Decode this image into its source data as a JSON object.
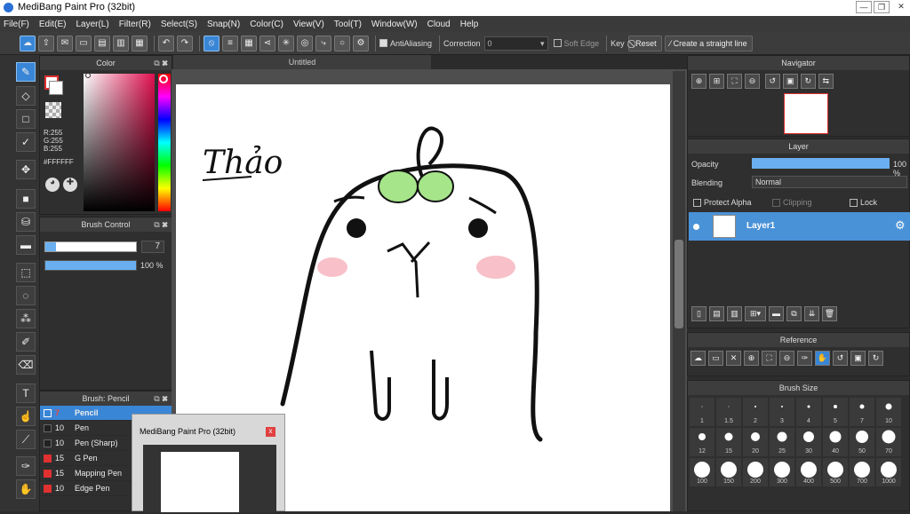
{
  "window": {
    "title": "MediBang Paint Pro (32bit)",
    "min": "—",
    "max": "❐",
    "close": "✕"
  },
  "menu": [
    "File(F)",
    "Edit(E)",
    "Layer(L)",
    "Filter(R)",
    "Select(S)",
    "Snap(N)",
    "Color(C)",
    "View(V)",
    "Tool(T)",
    "Window(W)",
    "Cloud",
    "Help"
  ],
  "toolbar": {
    "antialiasing": "AntiAliasing",
    "correction_label": "Correction",
    "correction_value": "0",
    "soft_edge": "Soft Edge",
    "key": "Key",
    "reset": "Reset",
    "straight_line": "Create a straight line"
  },
  "color_panel": {
    "title": "Color",
    "r": "R:255",
    "g": "G:255",
    "b": "B:255",
    "hex": "#FFFFFF"
  },
  "brush_control": {
    "title": "Brush Control",
    "size": "7",
    "opacity": "100 %",
    "opacity_value": 1.0
  },
  "brush_list": {
    "title": "Brush: Pencil",
    "items": [
      {
        "size": "7",
        "name": "Pencil",
        "color": "#2a6db5"
      },
      {
        "size": "10",
        "name": "Pen",
        "color": "#222222"
      },
      {
        "size": "10",
        "name": "Pen (Sharp)",
        "color": "#222222"
      },
      {
        "size": "15",
        "name": "G Pen",
        "color": "#e03030"
      },
      {
        "size": "15",
        "name": "Mapping Pen",
        "color": "#e03030"
      },
      {
        "size": "10",
        "name": "Edge Pen",
        "color": "#e03030"
      }
    ]
  },
  "document_tab": "Untitled",
  "canvas_text": "Thảo",
  "taskbar_preview": {
    "title": "MediBang Paint Pro (32bit)"
  },
  "navigator": {
    "title": "Navigator"
  },
  "layer_panel": {
    "title": "Layer",
    "opacity_label": "Opacity",
    "opacity_value": "100 %",
    "blending_label": "Blending",
    "blending_value": "Normal",
    "protect_alpha": "Protect Alpha",
    "clipping": "Clipping",
    "lock": "Lock",
    "layer_name": "Layer1"
  },
  "reference": {
    "title": "Reference"
  },
  "brush_size": {
    "title": "Brush Size",
    "row1": [
      "1",
      "1.5",
      "2",
      "3",
      "4",
      "5",
      "7",
      "10"
    ],
    "row2": [
      "12",
      "15",
      "20",
      "25",
      "30",
      "40",
      "50",
      "70"
    ],
    "row3": [
      "100",
      "150",
      "200",
      "300",
      "400",
      "500",
      "700",
      "1000"
    ]
  },
  "accent": "#3a86d6"
}
